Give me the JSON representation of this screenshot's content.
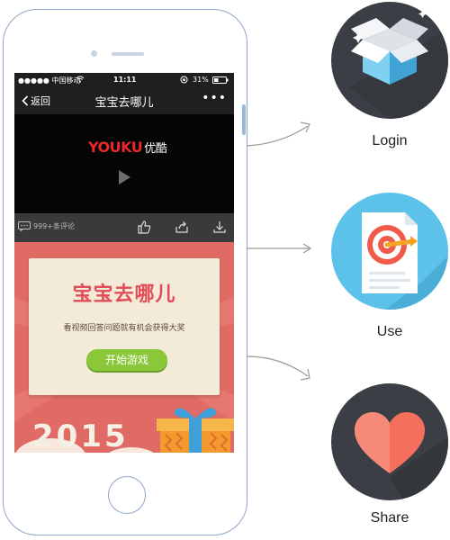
{
  "phone": {
    "status": {
      "carrier": "●●●●● 中国移动",
      "time": "11:11",
      "battery": "31%"
    },
    "nav": {
      "back_label": "返回",
      "title": "宝宝去哪儿",
      "more": "•••"
    },
    "video": {
      "logo_brand": "YOUKU",
      "logo_cn": "优酷"
    },
    "toolbar": {
      "comments": "999+条评论"
    },
    "banner": {
      "title": "宝宝去哪儿",
      "subtitle": "看视频回答问题就有机会获得大奖",
      "start_button": "开始游戏",
      "year": "2015"
    }
  },
  "steps": [
    {
      "label": "Login",
      "icon": "open-box-icon"
    },
    {
      "label": "Use",
      "icon": "target-document-icon"
    },
    {
      "label": "Share",
      "icon": "heart-icon"
    }
  ],
  "colors": {
    "icon_bg_dark": "#3b3f45",
    "icon_bg_blue": "#5cc2ea",
    "banner_red": "#e06a64",
    "button_green": "#8ac83a"
  }
}
